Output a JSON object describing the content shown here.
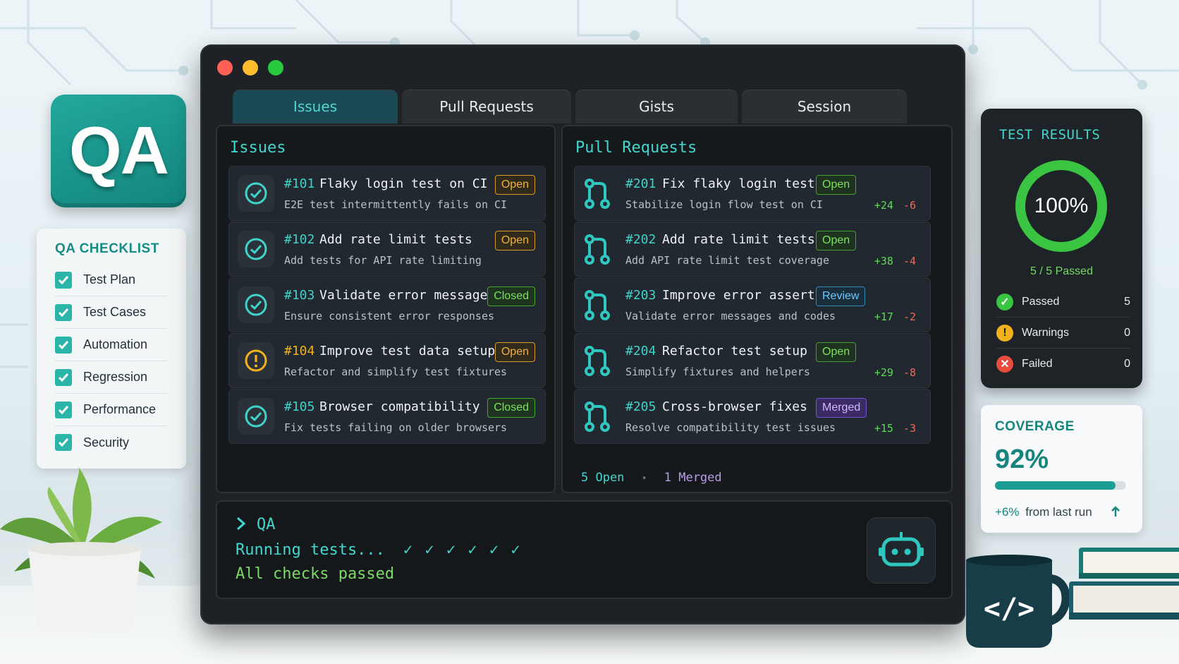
{
  "colors": {
    "accent": "#43d6cf",
    "window_bg": "#1e2226",
    "open": "#f3b23b",
    "closed": "#7be25b",
    "review": "#6cc9ff",
    "merged": "#cfb8ff",
    "dot_red": "#ff5f56",
    "dot_yellow": "#ffbd2e",
    "dot_green": "#27c93f"
  },
  "qa_badge": {
    "text": "QA"
  },
  "checklist": {
    "title": "QA CHECKLIST",
    "items": [
      {
        "label": "Test Plan",
        "checked": true
      },
      {
        "label": "Test Cases",
        "checked": true
      },
      {
        "label": "Automation",
        "checked": true
      },
      {
        "label": "Regression",
        "checked": true
      },
      {
        "label": "Performance",
        "checked": true
      },
      {
        "label": "Security",
        "checked": true
      }
    ]
  },
  "tabs": [
    {
      "label": "Issues",
      "active": true
    },
    {
      "label": "Pull Requests",
      "active": false
    },
    {
      "label": "Gists",
      "active": false
    },
    {
      "label": "Session",
      "active": false
    }
  ],
  "issues": {
    "title": "Issues",
    "items": [
      {
        "num": "#101",
        "title": "Flaky login test on CI",
        "desc": "E2E test intermittently fails on CI",
        "status": "Open",
        "icon": "check-circle-icon"
      },
      {
        "num": "#102",
        "title": "Add rate limit tests",
        "desc": "Add tests for API rate limiting",
        "status": "Open",
        "icon": "check-circle-icon"
      },
      {
        "num": "#103",
        "title": "Validate error messages",
        "desc": "Ensure consistent error responses",
        "status": "Closed",
        "icon": "check-circle-icon"
      },
      {
        "num": "#104",
        "title": "Improve test data setup",
        "desc": "Refactor and simplify test fixtures",
        "status": "Open",
        "icon": "warning-icon"
      },
      {
        "num": "#105",
        "title": "Browser compatibility",
        "desc": "Fix tests failing on older browsers",
        "status": "Closed",
        "icon": "check-circle-icon"
      }
    ]
  },
  "pull_requests": {
    "title": "Pull Requests",
    "items": [
      {
        "num": "#201",
        "title": "Fix flaky login test",
        "desc": "Stabilize login flow test on CI",
        "status": "Open",
        "additions": "+24",
        "deletions": "-6"
      },
      {
        "num": "#202",
        "title": "Add rate limit tests",
        "desc": "Add API rate limit test coverage",
        "status": "Open",
        "additions": "+38",
        "deletions": "-4"
      },
      {
        "num": "#203",
        "title": "Improve error assertions",
        "desc": "Validate error messages and codes",
        "status": "Review",
        "additions": "+17",
        "deletions": "-2"
      },
      {
        "num": "#204",
        "title": "Refactor test setup",
        "desc": "Simplify fixtures and helpers",
        "status": "Open",
        "additions": "+29",
        "deletions": "-8"
      },
      {
        "num": "#205",
        "title": "Cross-browser fixes",
        "desc": "Resolve compatibility test issues",
        "status": "Merged",
        "additions": "+15",
        "deletions": "-3"
      }
    ],
    "summary_open": "5 Open",
    "summary_sep": "•",
    "summary_merged": "1 Merged"
  },
  "terminal": {
    "prompt": "QA",
    "running": "Running tests...",
    "checks": "✓  ✓  ✓  ✓  ✓  ✓",
    "result": "All checks passed"
  },
  "test_results": {
    "title": "TEST RESULTS",
    "percent": "100%",
    "percent_value": 1.0,
    "summary": "5 / 5 Passed",
    "rows": [
      {
        "label": "Passed",
        "value": "5",
        "icon": "check-icon"
      },
      {
        "label": "Warnings",
        "value": "0",
        "icon": "warning-icon"
      },
      {
        "label": "Failed",
        "value": "0",
        "icon": "x-icon"
      }
    ]
  },
  "coverage": {
    "title": "COVERAGE",
    "value": "92%",
    "fraction": 0.92,
    "delta": "+6%",
    "delta_text": "from last run"
  },
  "mug": {
    "icon": "code-icon",
    "text": "</>"
  }
}
